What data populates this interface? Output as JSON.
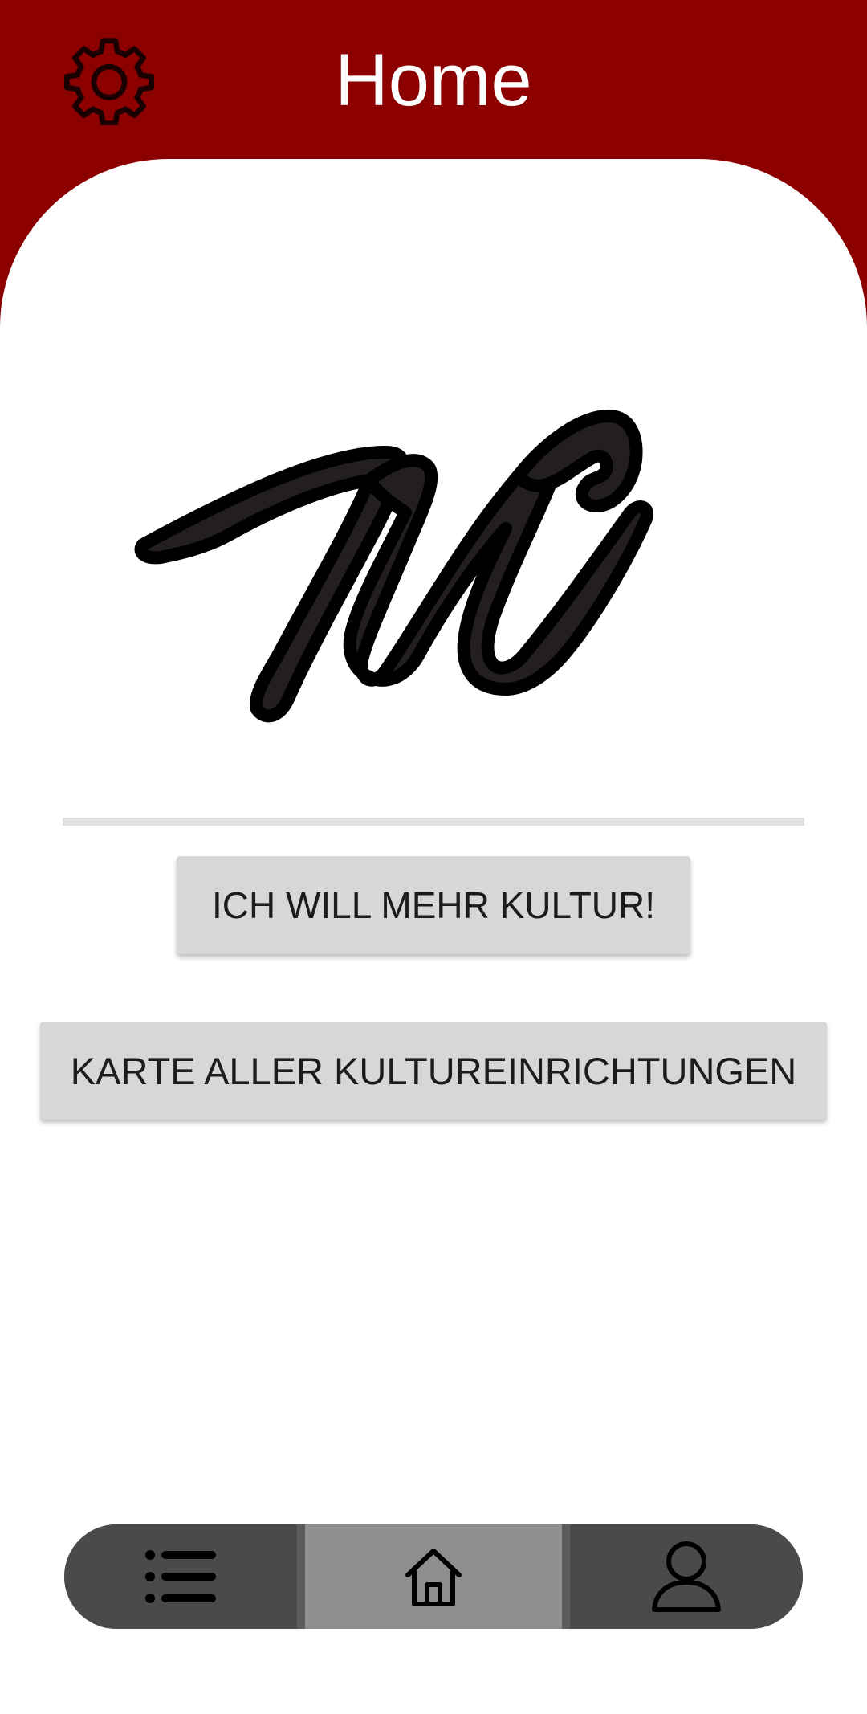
{
  "header": {
    "title": "Home",
    "settings_icon": "gear-icon"
  },
  "logo": {
    "text": "MC",
    "description_icon": "mc-script-logo"
  },
  "buttons": {
    "kultur_label": "ICH WILL MEHR KULTUR!",
    "karte_label": "KARTE ALLER KULTUREINRICHTUNGEN"
  },
  "bottom_nav": {
    "items": [
      {
        "icon": "list-icon",
        "active": false
      },
      {
        "icon": "home-icon",
        "active": true
      },
      {
        "icon": "person-icon",
        "active": false
      }
    ]
  },
  "colors": {
    "header_bg": "#8c0000",
    "button_bg": "#d6d8d8",
    "nav_bg": "#4a4a4a",
    "nav_active_bg": "#8e8e8e"
  }
}
